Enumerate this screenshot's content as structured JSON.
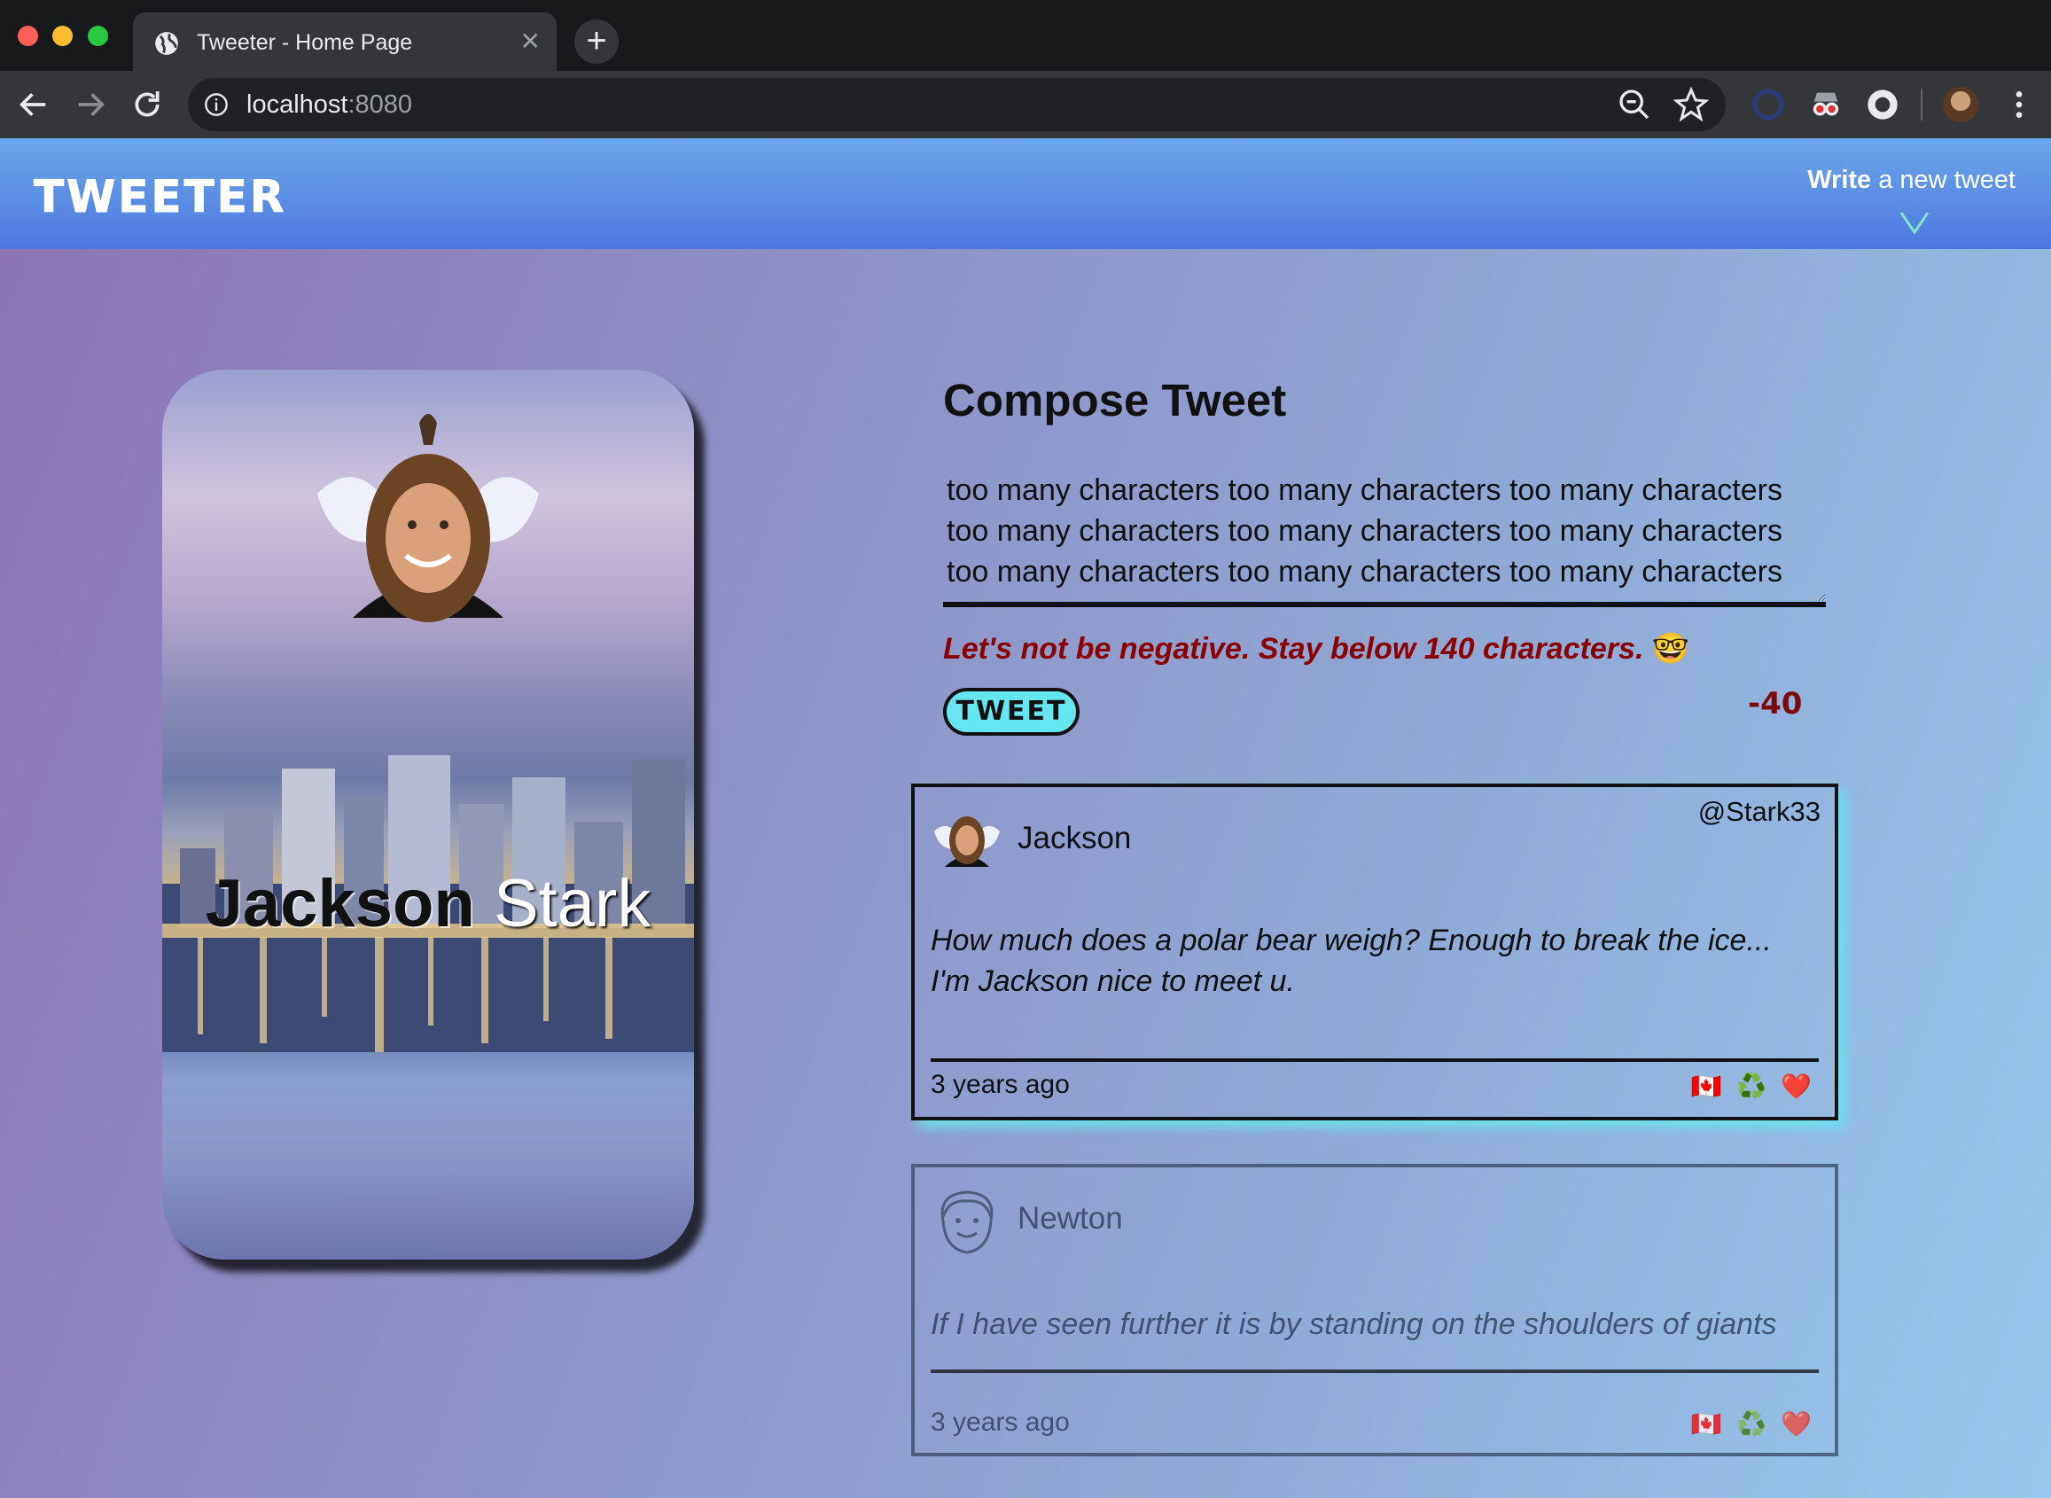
{
  "browser": {
    "tab_title": "Tweeter - Home Page",
    "url_host": "localhost",
    "url_port": ":8080"
  },
  "nav": {
    "brand": "TWEETER",
    "write_bold": "Write",
    "write_rest": " a new tweet"
  },
  "profile": {
    "first_name": "Jackson",
    "last_name": "Stark"
  },
  "compose": {
    "title": "Compose Tweet",
    "text": "too many characters too many characters too many characters too many characters too many characters too many characters too many characters too many characters too many characters",
    "error": "Let's not be negative. Stay below 140 characters.",
    "error_emoji": "🤓",
    "button": "TWEET",
    "counter": "-40"
  },
  "tweets": [
    {
      "name": "Jackson",
      "handle": "@Stark33",
      "body": "How much does a polar bear weigh? Enough to break the ice... I'm Jackson nice to meet u.",
      "time": "3 years ago",
      "actions": [
        "🇨🇦",
        "♻️",
        "❤️"
      ]
    },
    {
      "name": "Newton",
      "handle": "",
      "body": "If I have seen further it is by standing on the shoulders of giants",
      "time": "3 years ago",
      "actions": [
        "🇨🇦",
        "♻️",
        "❤️"
      ]
    }
  ],
  "colors": {
    "nav_top": "#6aa7e8",
    "nav_bottom": "#4d78e0",
    "tweet_button": "#66e6f0",
    "error": "#8b0000",
    "counter": "#7c0a0a"
  }
}
